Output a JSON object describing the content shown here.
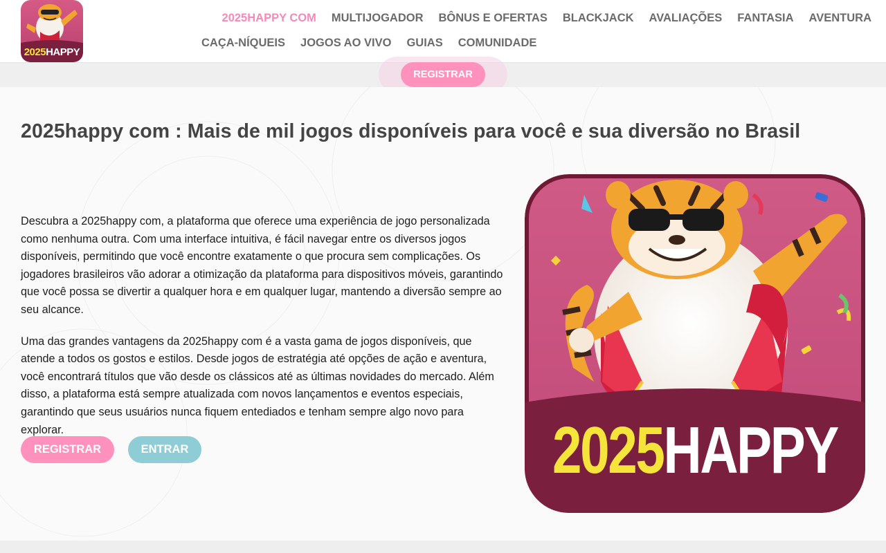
{
  "brand": {
    "logo_text": "2025HAPPY",
    "hero_text_a": "2025",
    "hero_text_b": "HAPPY"
  },
  "nav": {
    "row1": [
      {
        "label": "2025HAPPY COM",
        "active": true
      },
      {
        "label": "MULTIJOGADOR"
      },
      {
        "label": "BÔNUS E OFERTAS"
      },
      {
        "label": "BLACKJACK"
      },
      {
        "label": "AVALIAÇÕES"
      },
      {
        "label": "FANTASIA"
      },
      {
        "label": "AVENTURA"
      }
    ],
    "row2": [
      {
        "label": "CAÇA-NÍQUEIS"
      },
      {
        "label": "JOGOS AO VIVO"
      },
      {
        "label": "GUIAS"
      },
      {
        "label": "COMUNIDADE"
      }
    ]
  },
  "subbar": {
    "register_label": "REGISTRAR"
  },
  "main": {
    "title": "2025happy com : Mais de mil jogos disponíveis para você e sua diversão no Brasil",
    "paragraphs": [
      "Descubra a 2025happy com, a plataforma que oferece uma experiência de jogo personalizada como nenhuma outra. Com uma interface intuitiva, é fácil navegar entre os diversos jogos disponíveis, permitindo que você encontre exatamente o que procura sem complicações. Os jogadores brasileiros vão adorar a otimização da plataforma para dispositivos móveis, garantindo que você possa se divertir a qualquer hora e em qualquer lugar, mantendo a diversão sempre ao seu alcance.",
      "Uma das grandes vantagens da 2025happy com é a vasta gama de jogos disponíveis, que atende a todos os gostos e estilos. Desde jogos de estratégia até opções de ação e aventura, você encontrará títulos que vão desde os clássicos até as últimas novidades do mercado. Além disso, a plataforma está sempre atualizada com novos lançamentos e eventos especiais, garantindo que seus usuários nunca fiquem entediados e tenham sempre algo novo para explorar."
    ],
    "register_label": "REGISTRAR",
    "login_label": "ENTRAR"
  },
  "colors": {
    "accent_pink": "#ff91bd",
    "accent_teal": "#8fcdd6",
    "brand_maroon": "#7a1f3d",
    "brand_yellow": "#f5e43a"
  },
  "icons": {
    "logo": "tiger-mascot-logo",
    "hero": "tiger-mascot-hero"
  }
}
